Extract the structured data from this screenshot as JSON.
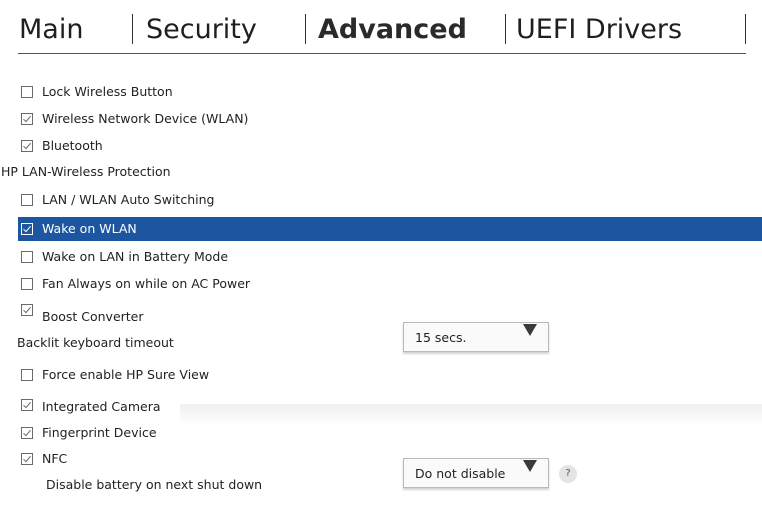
{
  "tabs": [
    {
      "label": "Main"
    },
    {
      "label": "Security"
    },
    {
      "label": "Advanced",
      "active": true
    },
    {
      "label": "UEFI Drivers"
    }
  ],
  "settings": {
    "lock_wireless": {
      "label": "Lock Wireless Button",
      "checked": false
    },
    "wlan": {
      "label": "Wireless Network Device (WLAN)",
      "checked": true
    },
    "bluetooth": {
      "label": "Bluetooth",
      "checked": true
    },
    "lan_wireless_heading": "HP LAN-Wireless Protection",
    "lan_wlan_switch": {
      "label": "LAN / WLAN Auto Switching",
      "checked": false
    },
    "wake_wlan": {
      "label": "Wake on WLAN",
      "checked": true
    },
    "wake_lan_battery": {
      "label": "Wake on LAN in Battery Mode",
      "checked": false
    },
    "fan_always_on": {
      "label": "Fan Always on while on AC Power",
      "checked": false
    },
    "boost_converter": {
      "label": "Boost Converter",
      "checked": true
    },
    "backlit_timeout": {
      "label": "Backlit keyboard timeout",
      "value": "15 secs."
    },
    "sure_view": {
      "label": "Force enable HP Sure View",
      "checked": false
    },
    "camera": {
      "label": "Integrated Camera",
      "checked": true
    },
    "fingerprint": {
      "label": "Fingerprint Device",
      "checked": true
    },
    "nfc": {
      "label": "NFC",
      "checked": true
    },
    "disable_battery": {
      "label": "Disable battery on next shut down",
      "value": "Do not disable"
    }
  },
  "help": {
    "symbol": "?"
  },
  "colors": {
    "highlight": "#1c56a0",
    "text": "#222222"
  }
}
